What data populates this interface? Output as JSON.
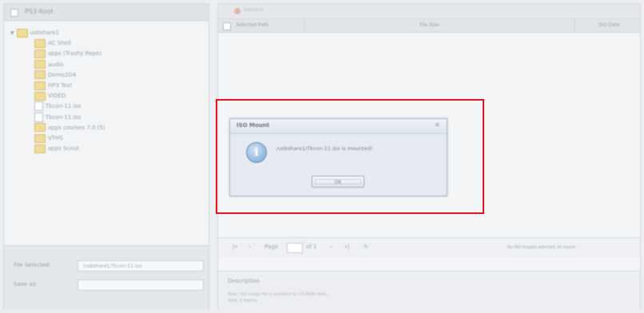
{
  "left": {
    "select_all_label": "PS3 Root",
    "tree": [
      {
        "label": "usbshare1",
        "type": "folder",
        "level": 0
      },
      {
        "label": "AC Shell",
        "type": "folder",
        "level": 1
      },
      {
        "label": "apps (Trashy Repo)",
        "type": "folder",
        "level": 1
      },
      {
        "label": "audio",
        "type": "folder",
        "level": 1
      },
      {
        "label": "Demo2D4",
        "type": "folder",
        "level": 1
      },
      {
        "label": "HP3 Test",
        "type": "folder",
        "level": 1
      },
      {
        "label": "VIDEO",
        "type": "folder",
        "level": 1
      },
      {
        "label": "Tkcon-11.iso",
        "type": "file",
        "level": 1
      },
      {
        "label": "Tkcon-11.iso",
        "type": "file",
        "level": 1
      },
      {
        "label": "apps courses 7.0 (5)",
        "type": "folder",
        "level": 1
      },
      {
        "label": "VTHS",
        "type": "folder",
        "level": 1
      },
      {
        "label": "apps Scout",
        "type": "folder",
        "level": 1
      }
    ],
    "file_selected_label": "File Selected:",
    "file_selected_value": "/usbshare1/Tkcon-11.iso",
    "save_as_label": "Save as:",
    "save_as_value": ""
  },
  "right": {
    "toolbar_label": "Remove",
    "columns": [
      "Selected Path",
      "File Size",
      "ISO Date"
    ],
    "pager": {
      "first": "|«",
      "prev": "‹",
      "page_label": "Page",
      "page_value": "",
      "of_label": "of 1",
      "next": "›",
      "last": "»|",
      "refresh": "↻",
      "status": "No ISO images selected, to mount"
    },
    "description_title": "Description",
    "description_lines": [
      "Note: ISO image file is mounted as CD-ROM drive.",
      "Total: 0 item(s)"
    ]
  },
  "dialog": {
    "title": "ISO Mount",
    "close": "×",
    "icon": "i",
    "message": "/usbshare1/Tkcon-11.iso is mounted!",
    "ok_label": "OK"
  },
  "colors": {
    "highlight": "#e8141c",
    "dialog_bg": "#e6ebf2"
  }
}
